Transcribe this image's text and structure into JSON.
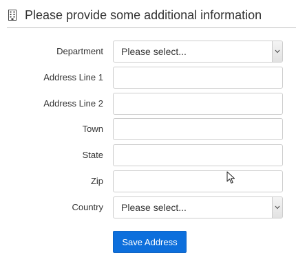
{
  "header": {
    "title": "Please provide some additional information",
    "icon": "building-icon"
  },
  "form": {
    "department": {
      "label": "Department",
      "value": "Please select..."
    },
    "address_line_1": {
      "label": "Address Line 1",
      "value": ""
    },
    "address_line_2": {
      "label": "Address Line 2",
      "value": ""
    },
    "town": {
      "label": "Town",
      "value": ""
    },
    "state": {
      "label": "State",
      "value": ""
    },
    "zip": {
      "label": "Zip",
      "value": ""
    },
    "country": {
      "label": "Country",
      "value": "Please select..."
    },
    "save_label": "Save Address"
  },
  "colors": {
    "primary_button": "#0d6fdc",
    "input_border": "#cccccc",
    "text": "#333333"
  }
}
